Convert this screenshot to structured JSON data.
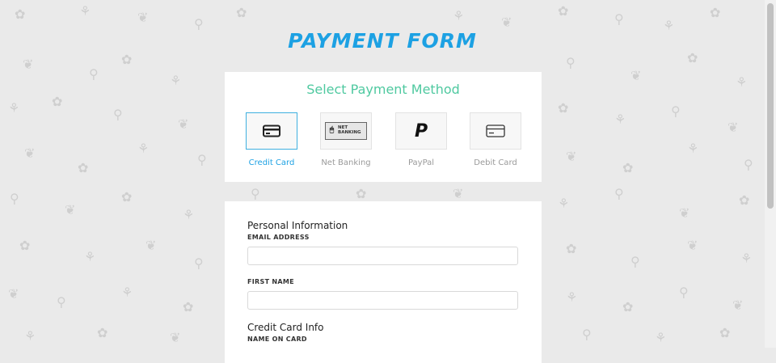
{
  "page": {
    "title": "PAYMENT FORM"
  },
  "payment_methods": {
    "heading": "Select Payment Method",
    "items": [
      {
        "label": "Credit Card",
        "icon": "credit-card-icon",
        "selected": true
      },
      {
        "label": "Net Banking",
        "icon": "net-banking-icon",
        "badge_line1": "NET",
        "badge_line2": "BANKING",
        "selected": false
      },
      {
        "label": "PayPal",
        "icon": "paypal-icon",
        "glyph": "P",
        "selected": false
      },
      {
        "label": "Debit Card",
        "icon": "debit-card-icon",
        "selected": false
      }
    ]
  },
  "form": {
    "personal_info_title": "Personal Information",
    "email_label": "EMAIL ADDRESS",
    "email_value": "",
    "first_name_label": "FIRST NAME",
    "first_name_value": "",
    "card_info_title": "Credit Card Info",
    "name_on_card_label": "NAME ON CARD"
  },
  "colors": {
    "accent": "#1da1e3",
    "heading_green": "#4fc9a0",
    "background": "#eaeaea"
  }
}
